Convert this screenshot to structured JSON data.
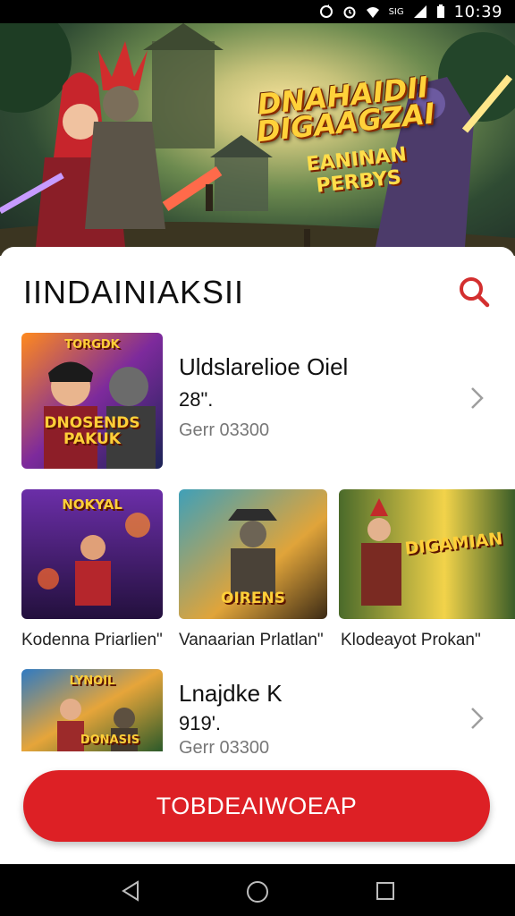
{
  "status_bar": {
    "time": "10:39",
    "icons": [
      "sync-icon",
      "alarm-icon",
      "wifi-icon",
      "signal-icon",
      "battery-icon"
    ],
    "network_label": "SIG"
  },
  "hero": {
    "title": "DNAHAIDII DIGAAGZAI",
    "subtitle": "EANINAN PERBYS"
  },
  "section": {
    "title": "IINDAINIAKSII"
  },
  "featured": [
    {
      "thumb_label": "DNOSENDS PAKUK",
      "thumb_top_label": "TORGDK",
      "title": "Uldslarelioe Oiel",
      "price": "28\".",
      "meta": "Gerr 03300"
    },
    {
      "thumb_label": "DONASIS",
      "thumb_top_label": "LYNOIL",
      "title": "Lnajdke K",
      "price": "919'.",
      "meta": "Gerr 03300"
    }
  ],
  "grid": [
    {
      "label": "Kodenna Priarlien\"",
      "thumb_label": "NOKYAL",
      "name": "grid-item-1"
    },
    {
      "label": "Vanaarian Prlatlan\"",
      "thumb_label": "OIRENS",
      "name": "grid-item-2"
    },
    {
      "label": "Klodeayot Prokan\"",
      "thumb_label": "DIGAMIAN",
      "name": "grid-item-3"
    }
  ],
  "cta": {
    "label": "TOBDEAIWOEAP"
  },
  "colors": {
    "accent": "#dd2025",
    "search": "#d32f2f",
    "chevron": "#9e9e9e"
  }
}
